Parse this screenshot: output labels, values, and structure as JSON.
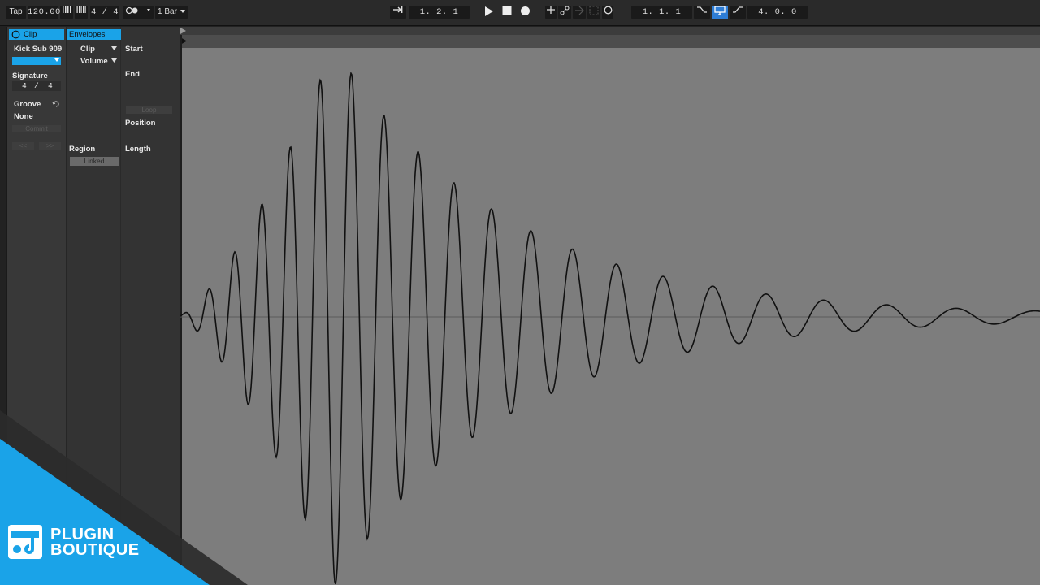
{
  "transport": {
    "tap_label": "Tap",
    "tempo": "120.00",
    "nudge_down_icon": "nudge-down-icon",
    "nudge_up_icon": "nudge-up-icon",
    "time_signature": "4 / 4",
    "metronome_icon": "metronome-icon",
    "quantization": "1 Bar",
    "follow_icon": "follow-arrow-icon",
    "arrangement_position": "1.  2.  1",
    "play_icon": "play-icon",
    "stop_icon": "stop-icon",
    "record_icon": "record-icon",
    "overdub_icon": "overdub-plus-icon",
    "automation_arm_icon": "automation-arm-icon",
    "reenable_icon": "reenable-automation-icon",
    "capture_icon": "capture-icon",
    "session_record_icon": "session-record-icon",
    "loop_start": "1.  1.  1",
    "punch_in_icon": "punch-in-icon",
    "loop_switch_icon": "loop-switch-icon",
    "punch_out_icon": "punch-out-icon",
    "loop_length": "4.  0.  0",
    "accent_color": "#2e7dd6"
  },
  "clip_panel": {
    "clip_header": "Clip",
    "clip_name": "Kick Sub 909",
    "signature_label": "Signature",
    "signature_numerator": "4",
    "signature_slash": "/",
    "signature_denominator": "4",
    "groove_label": "Groove",
    "groove_value": "None",
    "commit_label": "Commit",
    "nudge_back": "<<",
    "nudge_forward": ">>",
    "envelopes_header": "Envelopes",
    "envelope_device": "Clip",
    "envelope_control": "Volume",
    "start_label": "Start",
    "end_label": "End",
    "loop_label": "Loop",
    "position_label": "Position",
    "length_label": "Length",
    "region_label": "Region",
    "linked_label": "Linked",
    "header_color": "#1aa3e8"
  },
  "logo": {
    "line1": "PLUGIN",
    "line2": "BOUTIQUE",
    "color": "#1aa3e8"
  }
}
